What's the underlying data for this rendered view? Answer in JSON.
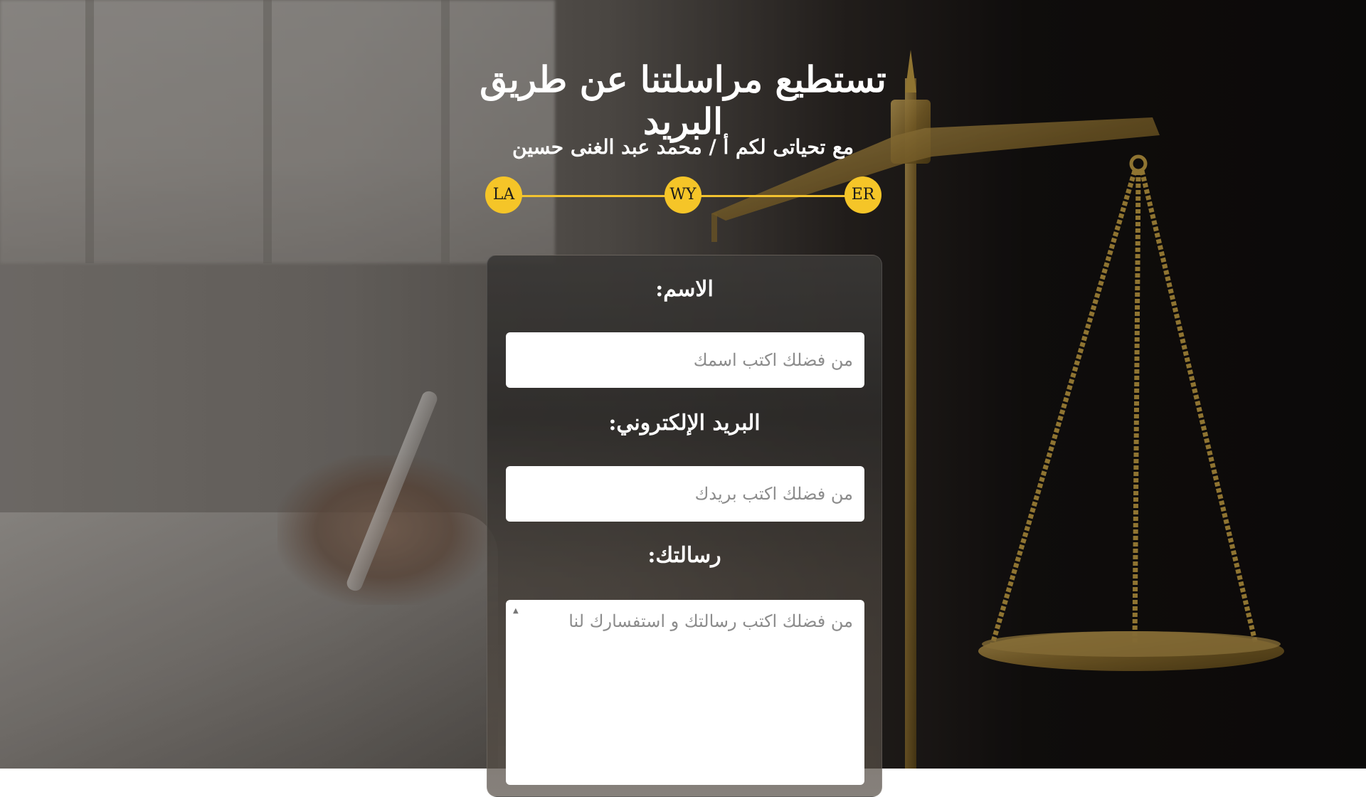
{
  "header": {
    "title": "تستطيع مراسلتنا عن طريق البريد",
    "subtitle": "مع تحياتى لكم أ / محمد عبد الغنى حسين"
  },
  "steps": [
    "LA",
    "WY",
    "ER"
  ],
  "form": {
    "name_label": "الاسم:",
    "name_placeholder": "من فضلك اكتب اسمك",
    "email_label": "البريد الإلكتروني:",
    "email_placeholder": "من فضلك اكتب بريدك",
    "message_label": "رسالتك:",
    "message_placeholder": "من فضلك اكتب رسالتك و استفسارك لنا"
  },
  "colors": {
    "accent": "#f5c528",
    "text": "#ffffff"
  },
  "background": {
    "icon": "scales-of-justice-icon"
  }
}
